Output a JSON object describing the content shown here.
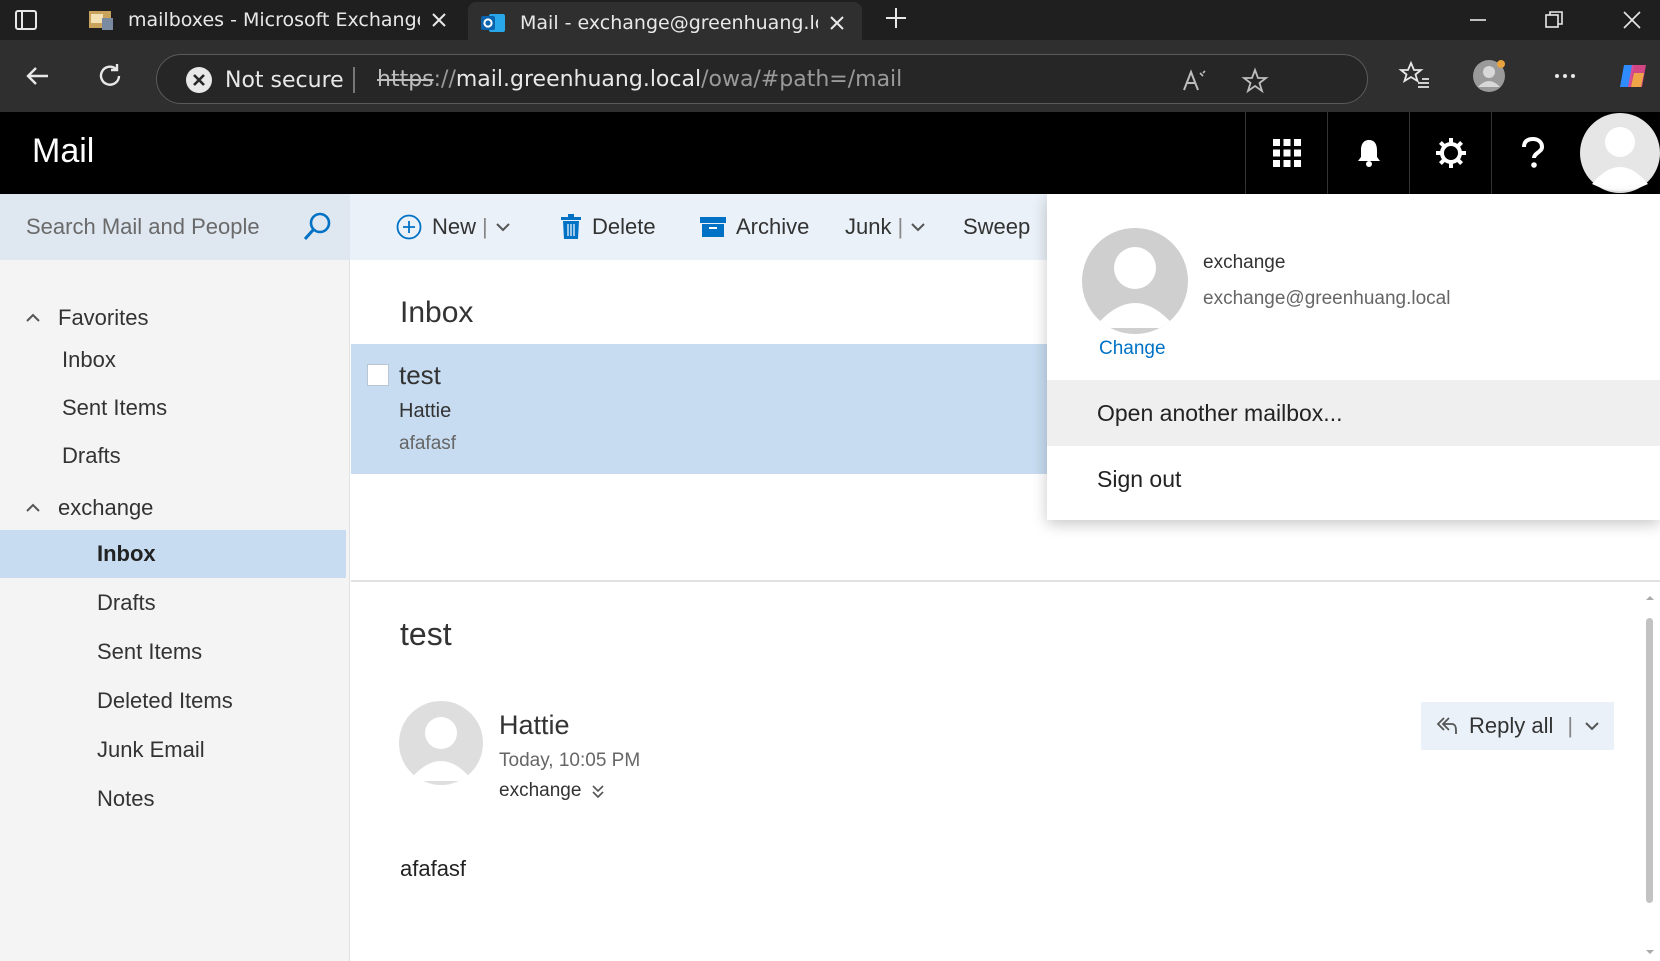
{
  "browser": {
    "tabs": [
      {
        "title": "mailboxes - Microsoft Exchange",
        "active": false
      },
      {
        "title": "Mail - exchange@greenhuang.local",
        "active": true
      }
    ],
    "security_label": "Not secure",
    "url": {
      "scheme": "https",
      "sep": "://",
      "host": "mail.greenhuang.local",
      "path": "/owa/#path=/mail"
    }
  },
  "owa": {
    "app_title": "Mail",
    "search_placeholder": "Search Mail and People",
    "commands": {
      "new": "New",
      "delete": "Delete",
      "archive": "Archive",
      "junk": "Junk",
      "sweep": "Sweep"
    },
    "folders": {
      "favorites_label": "Favorites",
      "favorites": [
        "Inbox",
        "Sent Items",
        "Drafts"
      ],
      "account_label": "exchange",
      "account_folders": [
        "Inbox",
        "Drafts",
        "Sent Items",
        "Deleted Items",
        "Junk Email",
        "Notes"
      ],
      "selected": "Inbox"
    },
    "list": {
      "title": "Inbox",
      "messages": [
        {
          "subject": "test",
          "from": "Hattie",
          "preview": "afafasf",
          "selected": true
        }
      ]
    },
    "reading": {
      "subject": "test",
      "sender": "Hattie",
      "time": "Today, 10:05 PM",
      "to": "exchange",
      "body": "afafasf",
      "reply_all_label": "Reply all"
    },
    "account_menu": {
      "name": "exchange",
      "email": "exchange@greenhuang.local",
      "change_label": "Change",
      "items": [
        "Open another mailbox...",
        "Sign out"
      ]
    }
  },
  "colors": {
    "header_bg": "#000000",
    "selection": "#c7dcf0",
    "command_bar": "#eaf1f8",
    "link": "#0072c6"
  }
}
